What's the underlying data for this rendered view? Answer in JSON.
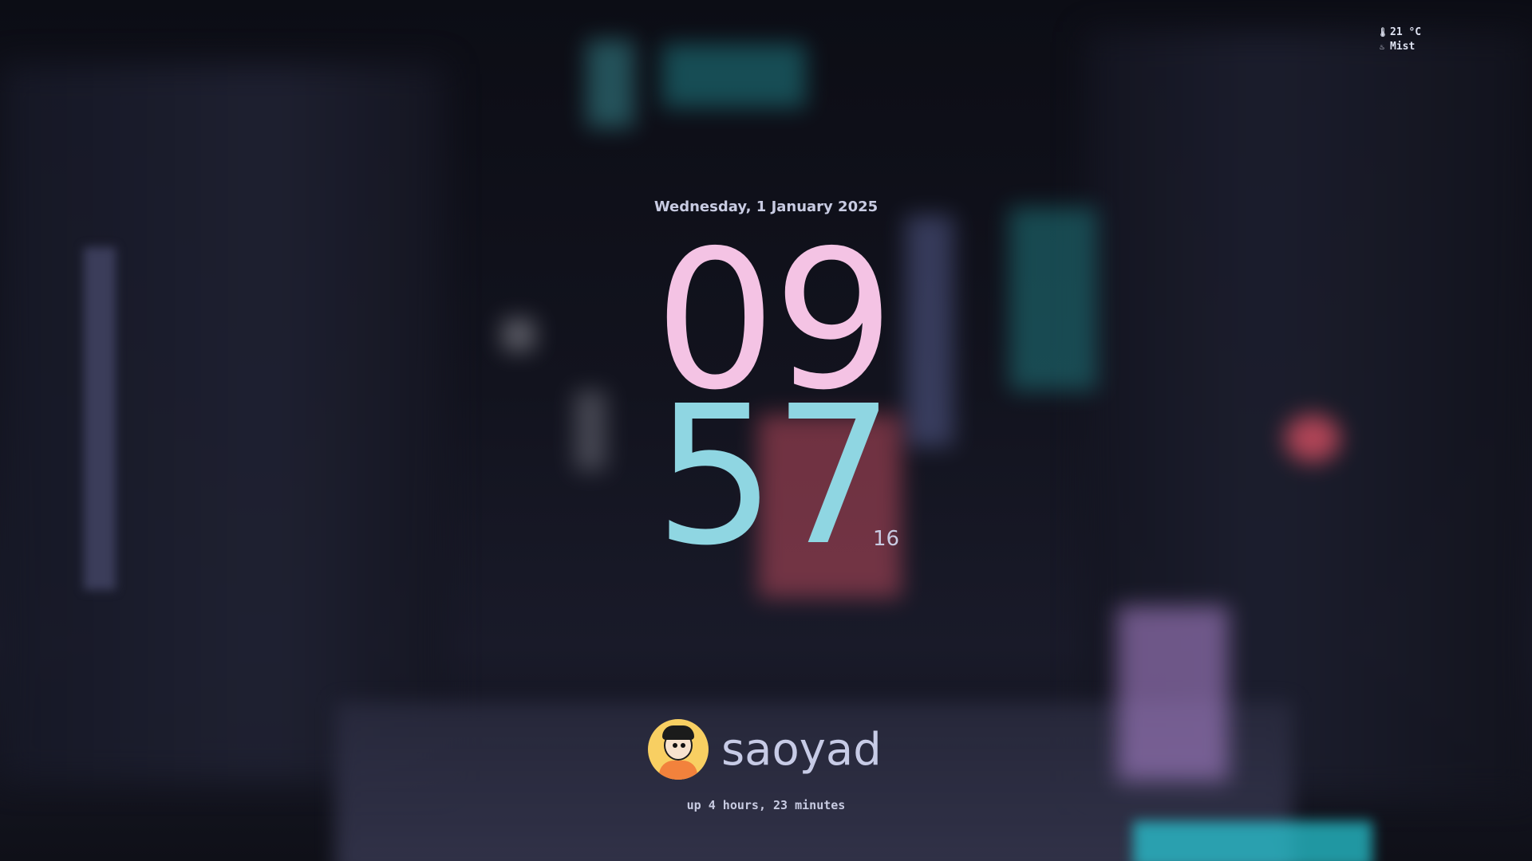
{
  "weather": {
    "temperature": "21 °C",
    "condition": "Mist",
    "temperature_icon": "thermometer-icon",
    "condition_icon": "mist-icon"
  },
  "date": "Wednesday, 1 January 2025",
  "clock": {
    "hours": "09",
    "minutes": "57",
    "seconds": "16"
  },
  "user": {
    "name": "saoyad",
    "avatar_icon": "avatar"
  },
  "uptime": "up 4 hours, 23 minutes",
  "colors": {
    "hours": "#f4c3e4",
    "minutes": "#8fd6e2",
    "text": "#c8cbe2",
    "background": "#0d0e16"
  }
}
